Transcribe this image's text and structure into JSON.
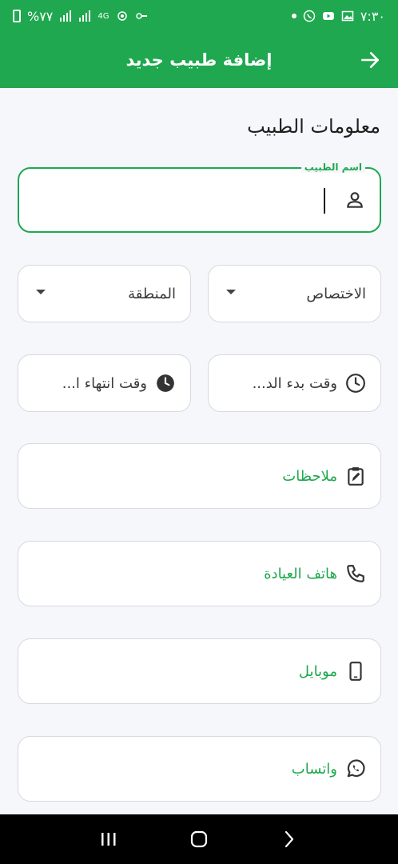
{
  "status_bar": {
    "time": "٧:٣٠",
    "battery": "%٧٧",
    "data_label": "4G"
  },
  "appbar": {
    "title": "إضافة طبيب جديد"
  },
  "form": {
    "section_title": "معلومات الطبيب",
    "doctor_name": {
      "label": "اسم الطبيب",
      "value": ""
    },
    "specialty": {
      "label": "الاختصاص"
    },
    "region": {
      "label": "المنطقة"
    },
    "start_time": {
      "label": "وقت بدء الد..."
    },
    "end_time": {
      "label": "وقت انتهاء ا..."
    },
    "notes": {
      "label": "ملاحظات"
    },
    "clinic_phone": {
      "label": "هاتف العيادة"
    },
    "mobile": {
      "label": "موبايل"
    },
    "whatsapp": {
      "label": "واتساب"
    }
  },
  "colors": {
    "primary": "#1FA84F",
    "background": "#F5F7FB",
    "border": "#D7D9DE"
  }
}
